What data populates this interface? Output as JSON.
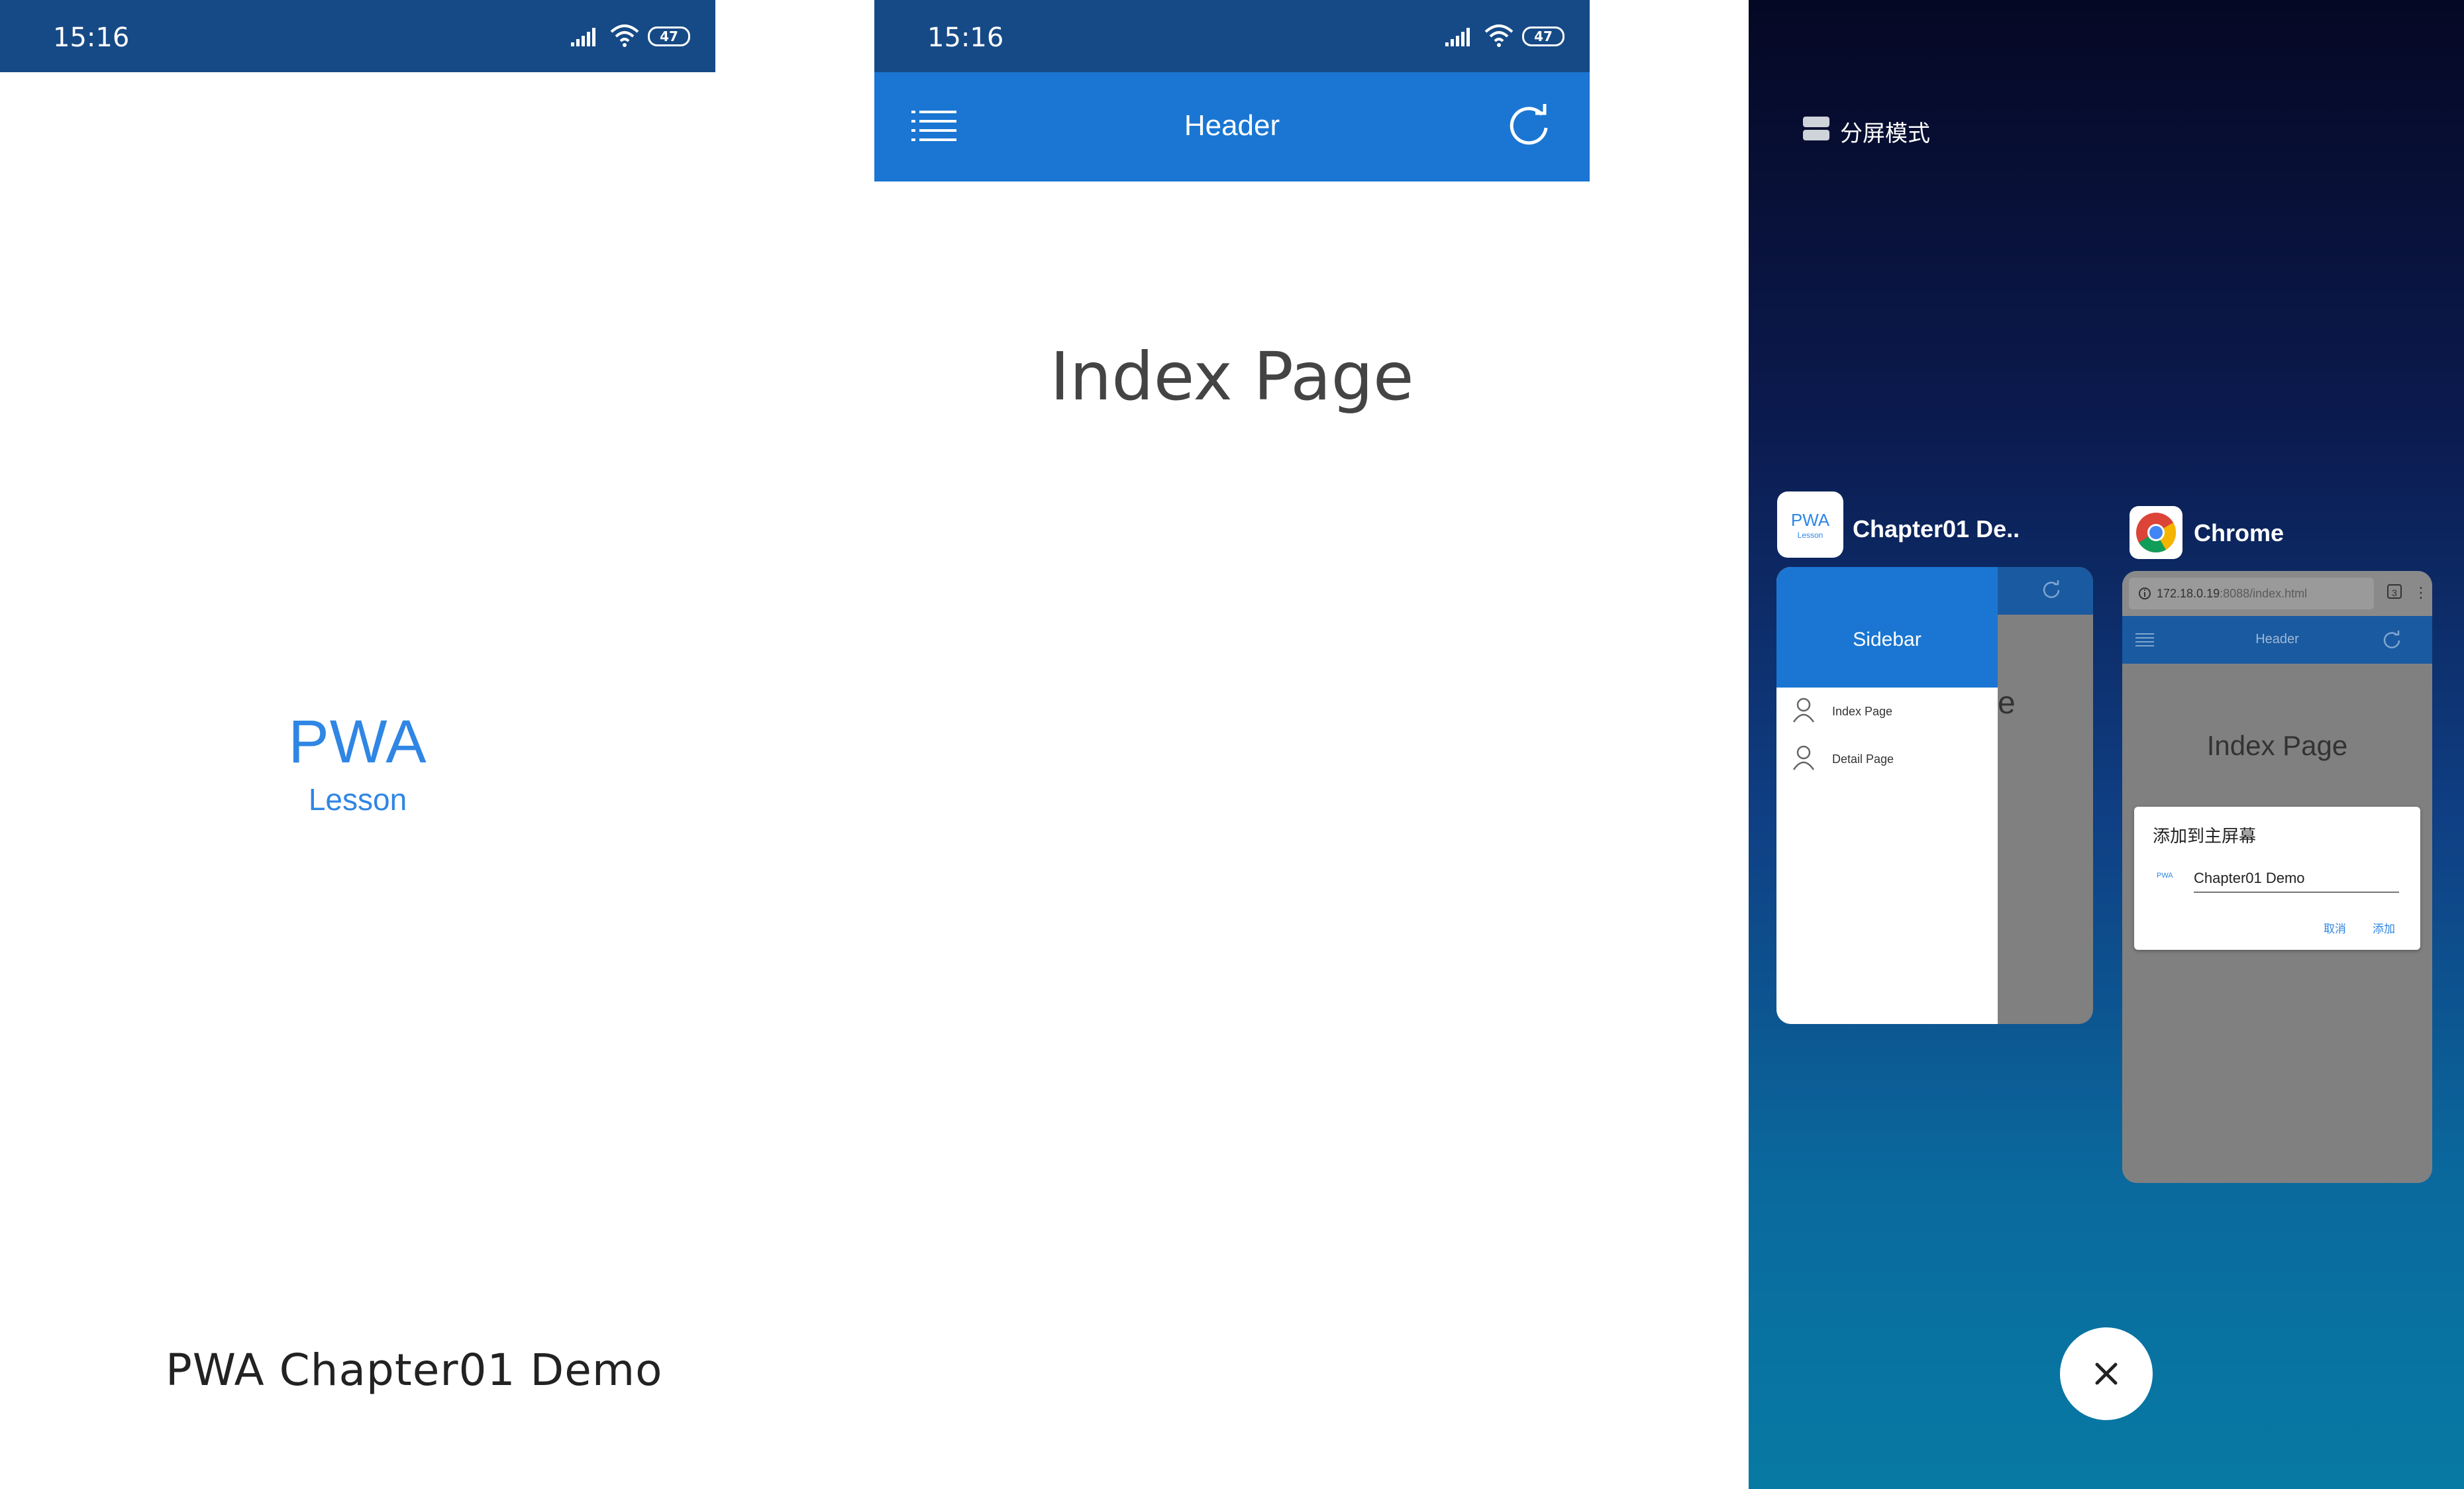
{
  "status_bar": {
    "time": "15:16",
    "battery": "47"
  },
  "splash": {
    "logo_title": "PWA",
    "logo_subtitle": "Lesson",
    "app_name": "PWA Chapter01 Demo"
  },
  "index_screen": {
    "header_title": "Header",
    "page_title": "Index Page"
  },
  "recents": {
    "split_mode_label": "分屏模式",
    "card1": {
      "app_label": "Chapter01 De..",
      "icon_title": "PWA",
      "icon_subtitle": "Lesson",
      "drawer_title": "Sidebar",
      "drawer_items": [
        {
          "label": "Index Page"
        },
        {
          "label": "Detail Page"
        }
      ],
      "peek_text": "e"
    },
    "card2": {
      "app_label": "Chrome",
      "url_host": "172.18.0.19",
      "url_path": ":8088/index.html",
      "tab_count": "3",
      "header_title": "Header",
      "page_title": "Index Page",
      "dialog": {
        "title": "添加到主屏幕",
        "icon_text": "PWA",
        "input_value": "Chapter01 Demo",
        "cancel_label": "取消",
        "add_label": "添加"
      }
    }
  },
  "colors": {
    "status_bar": "#164a86",
    "header": "#1a76d2",
    "logo_blue": "#2f86e4"
  }
}
